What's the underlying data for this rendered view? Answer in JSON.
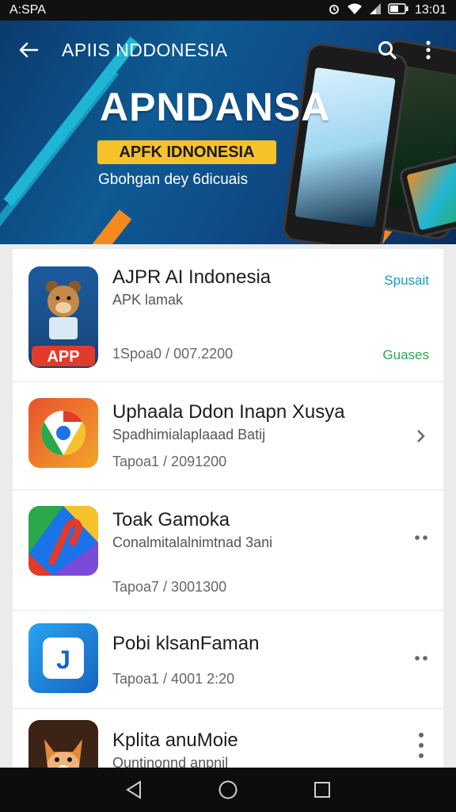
{
  "status_bar": {
    "left_text": "A:SPA",
    "time": "13:01"
  },
  "top_bar": {
    "title": "APIIS NDDONESIA"
  },
  "hero": {
    "title": "APNDANSA",
    "badge": "APFK IDNONESIA",
    "subtitle": "Gbohgan dey 6dicuais"
  },
  "apps": [
    {
      "name": "AJPR AI Indonesia",
      "sub": "APK lamak",
      "meta": "1Spoa0 / 007.2200",
      "action_top": "Spusait",
      "action_bottom": "Guases",
      "icon": "bear-app-icon",
      "icon_label": "APP"
    },
    {
      "name": "Uphaala Ddon Inapn Xusya",
      "sub": "Spadhimialaplaaad Batij",
      "meta": "Tapoa1 / 2091200",
      "icon": "chrome-icon"
    },
    {
      "name": "Toak Gamoka",
      "sub": "Conalmitalalnimtnad 3ani",
      "meta": "Tapoa7 / 3001300",
      "icon": "maps-icon"
    },
    {
      "name": "Pobi klsanFaman",
      "meta": "Tapoa1 / 4001 2:20",
      "icon": "jd-icon"
    },
    {
      "name": "Kplita anuMoie",
      "sub": "Ountinonnd anpnil",
      "icon": "fox-app-icon"
    }
  ],
  "colors": {
    "accent_blue": "#1a9bc4",
    "accent_green": "#2aa84a",
    "badge_yellow": "#f6c22a"
  }
}
